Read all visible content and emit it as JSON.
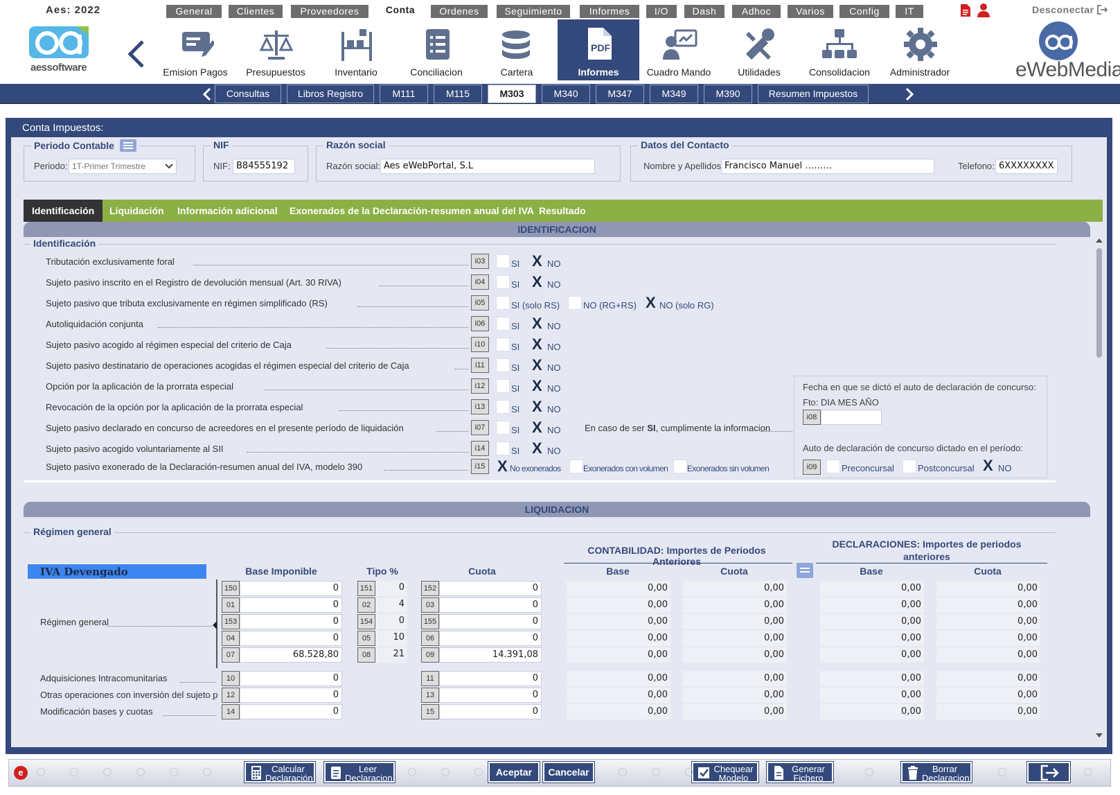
{
  "top": {
    "year_label": "Aes: 2022",
    "menu": [
      "General",
      "Clientes",
      "Proveedores",
      "Conta",
      "Ordenes",
      "Seguimiento",
      "Informes",
      "I/O",
      "Dash",
      "Adhoc",
      "Varios",
      "Config",
      "IT"
    ],
    "active_menu": "Conta",
    "disconnect": "Desconectar"
  },
  "icons": {
    "logo_text": "aessoftware",
    "brand_right": "eWebMedia",
    "items": [
      "Emision Pagos",
      "Presupuestos",
      "Inventario",
      "Conciliacion",
      "Cartera",
      "Informes",
      "Cuadro Mando",
      "Utilidades",
      "Consolidacion",
      "Administrador"
    ],
    "active": "Informes",
    "pdf_label": "PDF"
  },
  "subtabs": {
    "items": [
      "Consultas",
      "Libros Registro",
      "M111",
      "M115",
      "M303",
      "M340",
      "M347",
      "M349",
      "M390",
      "Resumen Impuestos"
    ],
    "active": "M303"
  },
  "panel": {
    "title": "Conta Impuestos:",
    "periodo": {
      "legend": "Periodo Contable",
      "label": "Periodo:",
      "value": "1T-Primer Trimestre"
    },
    "nif": {
      "legend": "NIF",
      "label": "NIF:",
      "value": "B84555192"
    },
    "razon": {
      "legend": "Razón social",
      "label": "Razón social:",
      "value": "Aes eWebPortal, S.L"
    },
    "contacto": {
      "legend": "Datos del Contacto",
      "name_label": "Nombre y Apellidos:",
      "name_value": "Francisco Manuel ………",
      "tel_label": "Telefono:",
      "tel_value": "6XXXXXXXX"
    }
  },
  "tabs": [
    "Identificación",
    "Liquidación",
    "Información adicional",
    "Exonerados de la Declaración-resumen anual del IVA",
    "Resultado"
  ],
  "ident": {
    "section_title": "IDENTIFICACION",
    "legend": "Identificación",
    "rows": [
      {
        "text": "Tributación exclusivamente foral",
        "code": "i03",
        "si": "SI",
        "no": "NO"
      },
      {
        "text": "Sujeto pasivo inscrito en el Registro de devolución mensual (Art. 30 RIVA)",
        "code": "i04",
        "si": "SI",
        "no": "NO"
      },
      {
        "text": "Sujeto pasivo que tributa exclusivamente en régimen simplificado (RS)",
        "code": "i05",
        "opts": [
          "SI (solo RS)",
          "NO (RG+RS)",
          "NO (solo RG)"
        ]
      },
      {
        "text": "Autoliquidación conjunta",
        "code": "i06",
        "si": "SI",
        "no": "NO"
      },
      {
        "text": "Sujeto pasivo acogido al régimen especial del criterio de Caja",
        "code": "i10",
        "si": "SI",
        "no": "NO"
      },
      {
        "text": "Sujeto pasivo destinatario de operaciones acogidas el régimen especial del criterio de Caja",
        "code": "i11",
        "si": "SI",
        "no": "NO"
      },
      {
        "text": "Opción por la aplicación de la prorrata especial",
        "code": "i12",
        "si": "SI",
        "no": "NO"
      },
      {
        "text": "Revocación de la opción por la aplicación de la prorrata especial",
        "code": "i13",
        "si": "SI",
        "no": "NO"
      },
      {
        "text": "Sujeto pasivo declarado en concurso de acreedores en el presente período de liquidación",
        "code": "i07",
        "si": "SI",
        "no": "NO"
      },
      {
        "text": "Sujeto pasivo acogido voluntariamente al SII",
        "code": "i14",
        "si": "SI",
        "no": "NO"
      },
      {
        "text": "Sujeto pasivo exonerado de la Declaración-resumen anual del IVA, modelo 390",
        "code": "i15",
        "opts": [
          "No exonerados",
          "Exonerados con volumen",
          "Exonerados sin volumen"
        ]
      }
    ],
    "concurso_note_a": "En caso de ser ",
    "concurso_note_b": "SI",
    "concurso_note_c": ", cumplimente la informacion",
    "fecha_title": "Fecha en que se dictó el auto de declaración de concurso:",
    "fecha_fmt": "Fto: DIA MES AÑO",
    "fecha_code": "i08",
    "auto_title": "Auto de declaración de concurso dictado en el período:",
    "auto_code": "i09",
    "auto_opts": [
      "Preconcursal",
      "Postconcursal",
      "NO"
    ],
    "x_mark": "X"
  },
  "liq": {
    "section_title": "LIQUIDACION",
    "legend": "Régimen general",
    "iva_title": "IVA Devengado",
    "cols": {
      "base": "Base Imponible",
      "tipo": "Tipo %",
      "cuota": "Cuota"
    },
    "cont_title": "CONTABILIDAD: Importes de Periodos Anteriores",
    "decl_title": "DECLARACIONES: Importes de periodos anteriores",
    "sub_base": "Base",
    "sub_cuota": "Cuota",
    "regimen_label": "Régimen general",
    "rows": [
      {
        "bcode": "150",
        "base": "0",
        "tcode": "151",
        "tipo": "0",
        "ccode": "152",
        "cuota": "0",
        "cb": "0,00",
        "cc": "0,00",
        "db": "0,00",
        "dc": "0,00"
      },
      {
        "bcode": "01",
        "base": "0",
        "tcode": "02",
        "tipo": "4",
        "ccode": "03",
        "cuota": "0",
        "cb": "0,00",
        "cc": "0,00",
        "db": "0,00",
        "dc": "0,00"
      },
      {
        "bcode": "153",
        "base": "0",
        "tcode": "154",
        "tipo": "0",
        "ccode": "155",
        "cuota": "0",
        "cb": "0,00",
        "cc": "0,00",
        "db": "0,00",
        "dc": "0,00"
      },
      {
        "bcode": "04",
        "base": "0",
        "tcode": "05",
        "tipo": "10",
        "ccode": "06",
        "cuota": "0",
        "cb": "0,00",
        "cc": "0,00",
        "db": "0,00",
        "dc": "0,00"
      },
      {
        "bcode": "07",
        "base": "68.528,80",
        "tcode": "08",
        "tipo": "21",
        "ccode": "09",
        "cuota": "14.391,08",
        "cb": "0,00",
        "cc": "0,00",
        "db": "0,00",
        "dc": "0,00"
      }
    ],
    "extra_rows": [
      {
        "label": "Adquisiciones Intracomunitarias",
        "bcode": "10",
        "base": "0",
        "ccode": "11",
        "cuota": "0",
        "cb": "0,00",
        "cc": "0,00",
        "db": "0,00",
        "dc": "0,00"
      },
      {
        "label": "Otras operaciones con inversión del sujeto pasivo",
        "bcode": "12",
        "base": "0",
        "ccode": "13",
        "cuota": "0",
        "cb": "0,00",
        "cc": "0,00",
        "db": "0,00",
        "dc": "0,00"
      },
      {
        "label": "Modificación bases y cuotas",
        "bcode": "14",
        "base": "0",
        "ccode": "15",
        "cuota": "0",
        "cb": "0,00",
        "cc": "0,00",
        "db": "0,00",
        "dc": "0,00"
      }
    ]
  },
  "footer": {
    "calcular": [
      "Calcular",
      "Declaración"
    ],
    "leer": [
      "Leer",
      "Declaracion"
    ],
    "aceptar": "Aceptar",
    "cancelar": "Cancelar",
    "chequear": [
      "Chequear",
      "Modelo"
    ],
    "generar": [
      "Generar",
      "Fichero"
    ],
    "borrar": [
      "Borrar",
      "Declaracion"
    ]
  },
  "colors": {
    "navy": "#34497b",
    "green": "#8bb045",
    "iva_blue": "#3d86f0"
  }
}
